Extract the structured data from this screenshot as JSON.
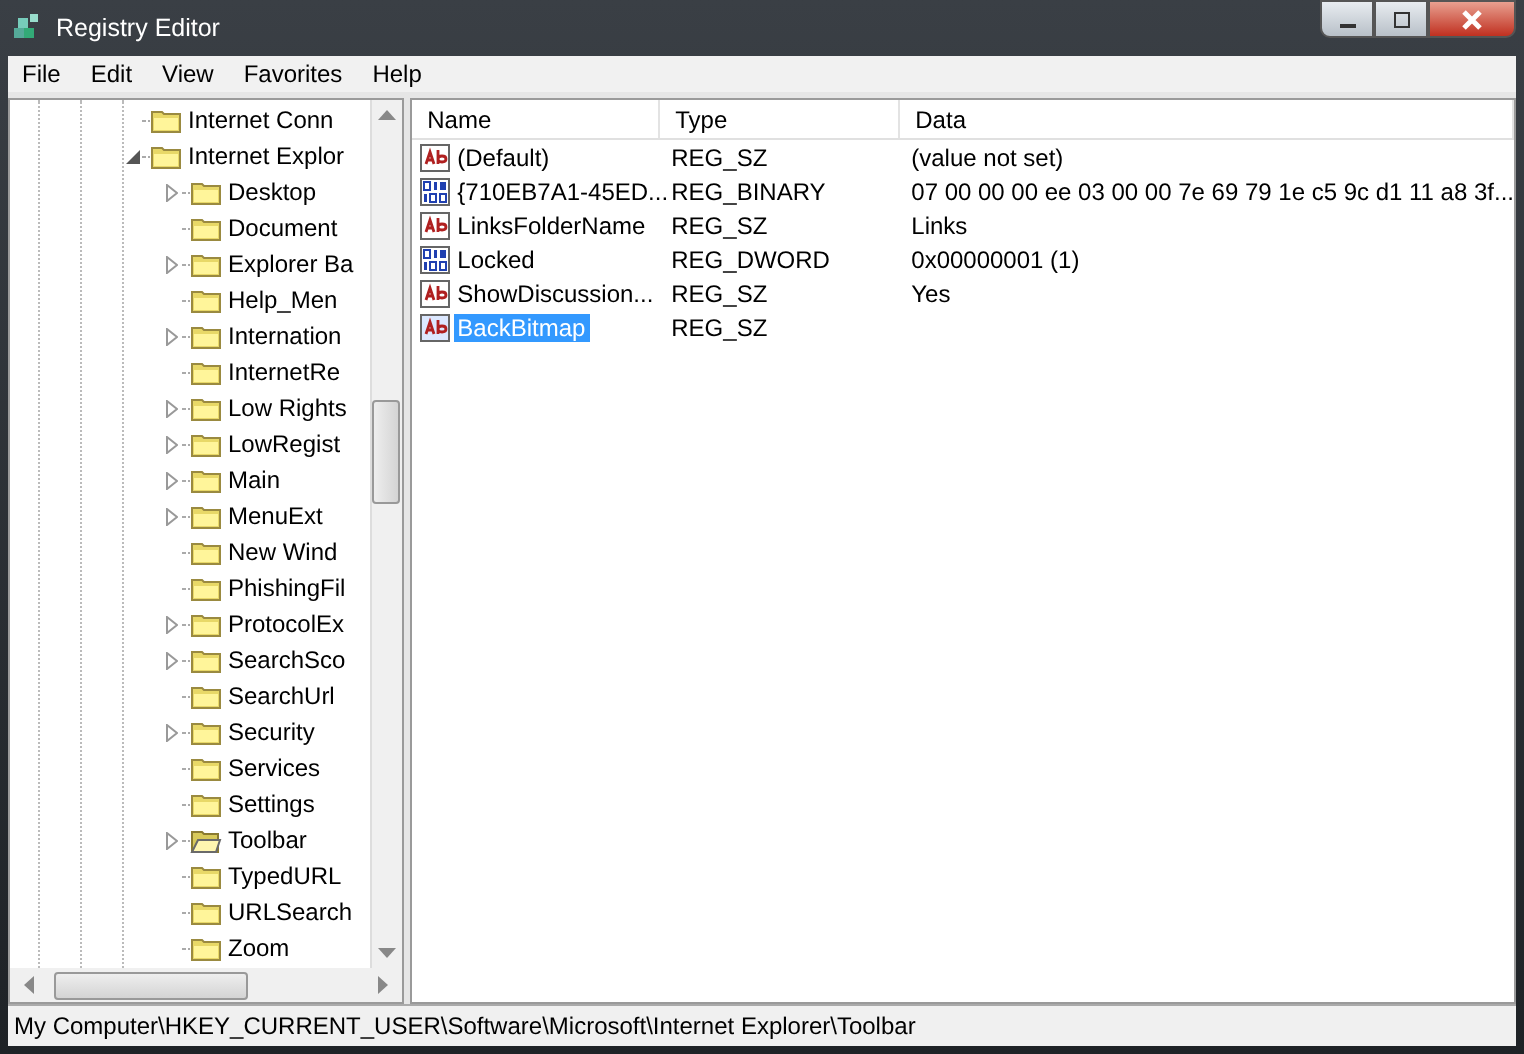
{
  "window": {
    "title": "Registry Editor"
  },
  "menu": [
    "File",
    "Edit",
    "View",
    "Favorites",
    "Help"
  ],
  "tree": {
    "items": [
      {
        "label": "Internet Conn",
        "kind": "leaf",
        "selected": false
      },
      {
        "label": "Internet Explor",
        "kind": "expanded",
        "selected": false,
        "children": [
          {
            "label": "Desktop",
            "kind": "collapsed",
            "selected": false
          },
          {
            "label": "Document",
            "kind": "leaf",
            "selected": false
          },
          {
            "label": "Explorer Ba",
            "kind": "collapsed",
            "selected": false
          },
          {
            "label": "Help_Men",
            "kind": "leaf",
            "selected": false
          },
          {
            "label": "Internation",
            "kind": "collapsed",
            "selected": false
          },
          {
            "label": "InternetRe",
            "kind": "leaf",
            "selected": false
          },
          {
            "label": "Low Rights",
            "kind": "collapsed",
            "selected": false
          },
          {
            "label": "LowRegist",
            "kind": "collapsed",
            "selected": false
          },
          {
            "label": "Main",
            "kind": "collapsed",
            "selected": false
          },
          {
            "label": "MenuExt",
            "kind": "collapsed",
            "selected": false
          },
          {
            "label": "New Wind",
            "kind": "leaf",
            "selected": false
          },
          {
            "label": "PhishingFil",
            "kind": "leaf",
            "selected": false
          },
          {
            "label": "ProtocolEx",
            "kind": "collapsed",
            "selected": false
          },
          {
            "label": "SearchSco",
            "kind": "collapsed",
            "selected": false
          },
          {
            "label": "SearchUrl",
            "kind": "leaf",
            "selected": false
          },
          {
            "label": "Security",
            "kind": "collapsed",
            "selected": false
          },
          {
            "label": "Services",
            "kind": "leaf",
            "selected": false
          },
          {
            "label": "Settings",
            "kind": "leaf",
            "selected": false
          },
          {
            "label": "Toolbar",
            "kind": "collapsed",
            "selected": true
          },
          {
            "label": "TypedURL",
            "kind": "leaf",
            "selected": false
          },
          {
            "label": "URLSearch",
            "kind": "leaf",
            "selected": false
          },
          {
            "label": "Zoom",
            "kind": "leaf",
            "selected": false
          }
        ]
      }
    ]
  },
  "table": {
    "columns": [
      "Name",
      "Type",
      "Data"
    ],
    "rows": [
      {
        "kind": "string",
        "name": "(Default)",
        "type": "REG_SZ",
        "data": "(value not set)",
        "selected": false
      },
      {
        "kind": "binary",
        "name": "{710EB7A1-45ED...",
        "type": "REG_BINARY",
        "data": "07 00 00 00 ee 03 00 00 7e 69 79 1e c5 9c d1 11 a8 3f...",
        "selected": false
      },
      {
        "kind": "string",
        "name": "LinksFolderName",
        "type": "REG_SZ",
        "data": "Links",
        "selected": false
      },
      {
        "kind": "binary",
        "name": "Locked",
        "type": "REG_DWORD",
        "data": "0x00000001 (1)",
        "selected": false
      },
      {
        "kind": "string",
        "name": "ShowDiscussion...",
        "type": "REG_SZ",
        "data": "Yes",
        "selected": false
      },
      {
        "kind": "string",
        "name": "BackBitmap",
        "type": "REG_SZ",
        "selected": true
      }
    ]
  },
  "status_bar": "My Computer\\HKEY_CURRENT_USER\\Software\\Microsoft\\Internet Explorer\\Toolbar"
}
